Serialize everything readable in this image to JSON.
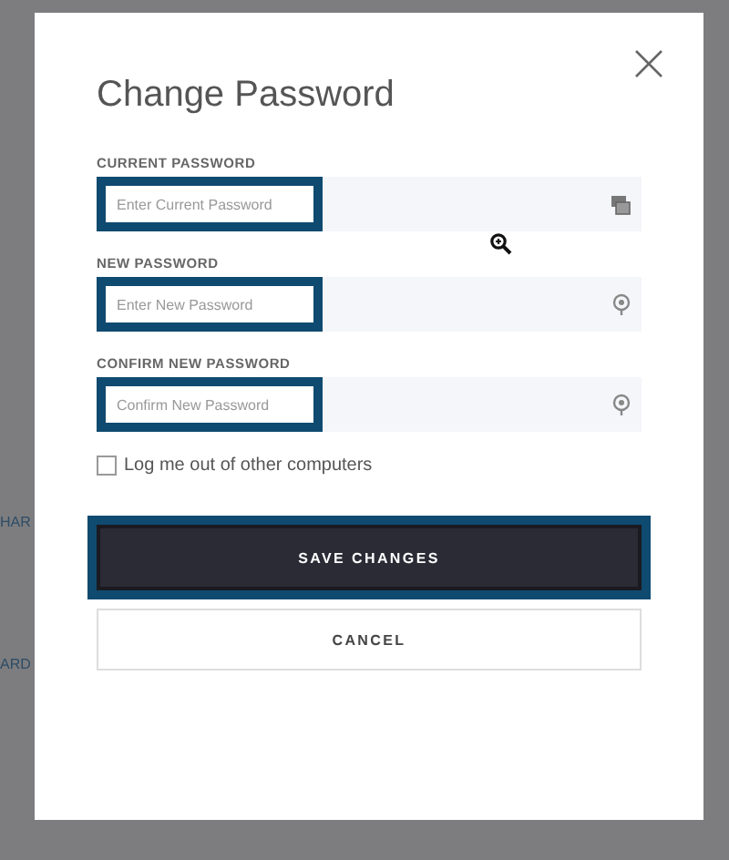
{
  "background_text": [
    "HAR",
    "ARD"
  ],
  "dialog": {
    "title": "Change Password",
    "fields": [
      {
        "label": "CURRENT PASSWORD",
        "placeholder": "Enter Current Password",
        "highlighted": true
      },
      {
        "label": "NEW PASSWORD",
        "placeholder": "Enter New Password",
        "highlighted": true
      },
      {
        "label": "CONFIRM NEW PASSWORD",
        "placeholder": "Confirm New Password",
        "highlighted": true
      }
    ],
    "checkbox": {
      "label": "Log me out of other computers",
      "checked": false
    },
    "buttons": [
      {
        "label": "SAVE CHANGES",
        "kind": "primary",
        "highlighted": true
      },
      {
        "label": "CANCEL",
        "kind": "secondary",
        "highlighted": false
      }
    ]
  }
}
